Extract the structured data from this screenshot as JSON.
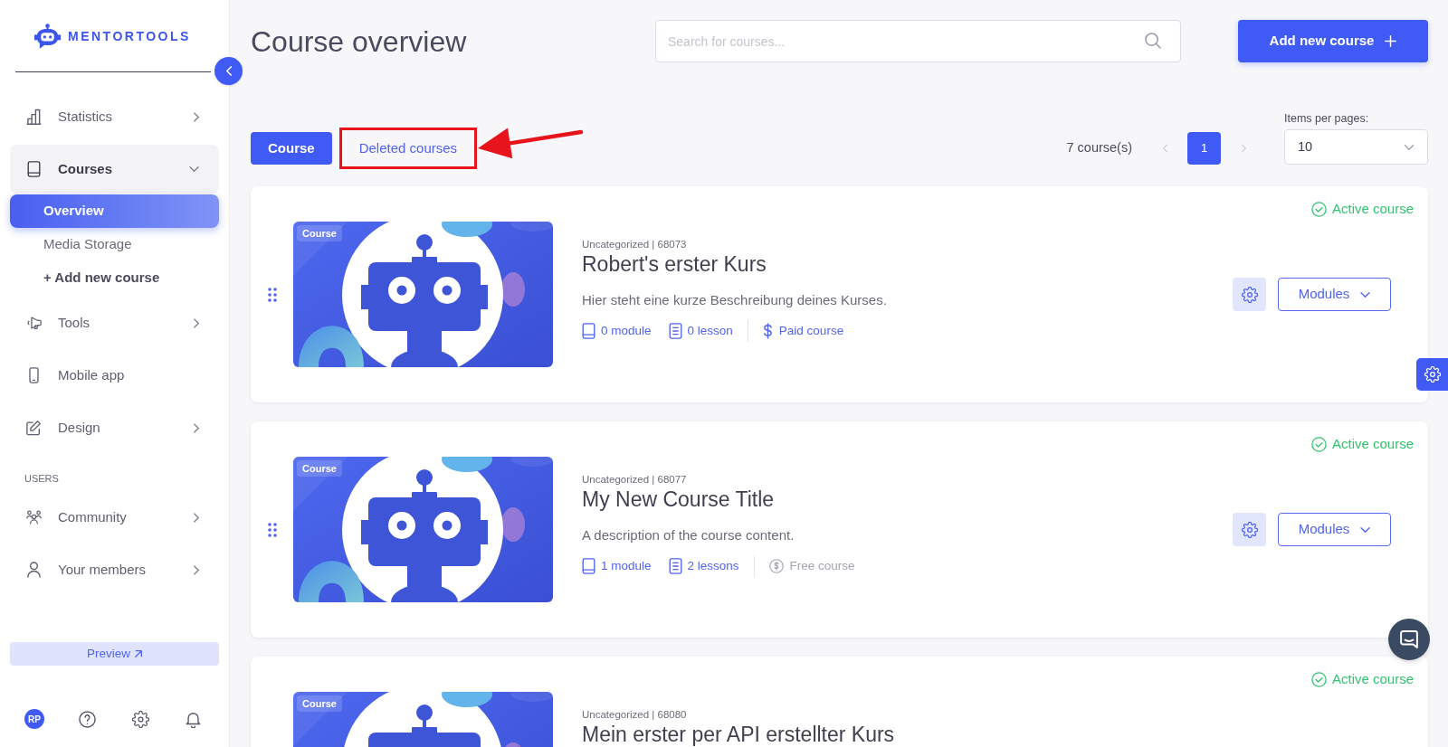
{
  "sidebar": {
    "logo": "MENTORTOOLS",
    "nav": [
      {
        "kind": "group",
        "label": "Statistics",
        "expanded": false
      },
      {
        "kind": "group",
        "label": "Courses",
        "expanded": true,
        "children": [
          {
            "label": "Overview",
            "selected": true
          },
          {
            "label": "Media Storage",
            "selected": false
          }
        ],
        "action": "+ Add new course"
      },
      {
        "kind": "group",
        "label": "Tools",
        "expanded": false
      },
      {
        "kind": "link",
        "label": "Mobile app"
      },
      {
        "kind": "group",
        "label": "Design",
        "expanded": false
      },
      {
        "kind": "heading",
        "label": "USERS"
      },
      {
        "kind": "group",
        "label": "Community",
        "expanded": false
      },
      {
        "kind": "group",
        "label": "Your members",
        "expanded": false
      }
    ],
    "preview_button": "Preview",
    "avatar": "RP"
  },
  "header": {
    "title": "Course overview",
    "search": {
      "placeholder": "Search for courses..."
    },
    "add_button": "Add new course"
  },
  "tabs": [
    {
      "label": "Course",
      "selected": true,
      "highlighted": false
    },
    {
      "label": "Deleted courses",
      "selected": false,
      "highlighted": true
    }
  ],
  "course_count": "7 course(s)",
  "pagination": {
    "pages": [
      {
        "label": "1",
        "selected": true
      }
    ]
  },
  "items_per_page": {
    "label": "Items per pages:",
    "value": "10"
  },
  "courses": [
    {
      "badge": "Course",
      "meta": "Uncategorized | 68073",
      "title": "Robert's erster Kurs",
      "description": "Hier steht eine kurze Beschreibung deines Kurses.",
      "modules": "0 module",
      "lessons": "0 lesson",
      "price": {
        "kind": "paid",
        "label": "Paid course"
      },
      "status": {
        "kind": "active",
        "label": "Active course"
      },
      "modules_button": "Modules"
    },
    {
      "badge": "Course",
      "meta": "Uncategorized | 68077",
      "title": "My New Course Title",
      "description": "A description of the course content.",
      "modules": "1 module",
      "lessons": "2 lessons",
      "price": {
        "kind": "free",
        "label": "Free course"
      },
      "status": {
        "kind": "active",
        "label": "Active course"
      },
      "modules_button": "Modules"
    },
    {
      "badge": "Course",
      "meta": "Uncategorized | 68080",
      "title": "Mein erster per API erstellter Kurs",
      "status": {
        "kind": "active",
        "label": "Active course"
      }
    }
  ]
}
